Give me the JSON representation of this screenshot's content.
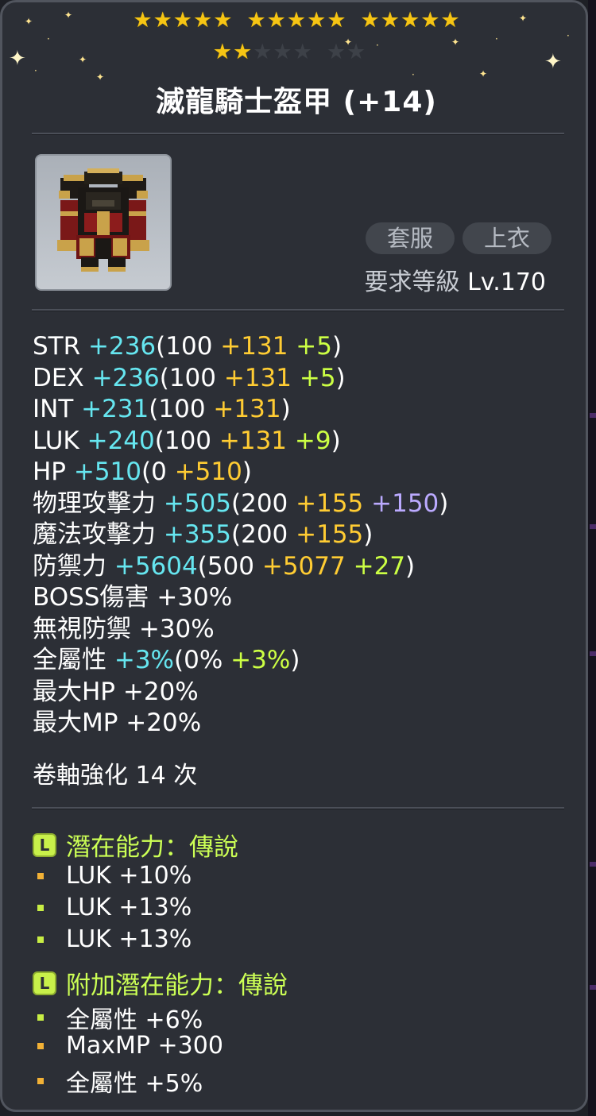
{
  "item": {
    "name": "滅龍騎士盔甲 (+14)",
    "stars_filled": 17,
    "stars_total": 22,
    "tags": [
      "套服",
      "上衣"
    ],
    "req_label": "要求等級",
    "req_value": "Lv.170"
  },
  "stats": [
    {
      "name": "STR",
      "parts": [
        {
          "t": "+236",
          "c": "cyan"
        },
        {
          "t": "(100 ",
          "c": "white"
        },
        {
          "t": "+131 ",
          "c": "gold"
        },
        {
          "t": "+5",
          "c": "lime"
        },
        {
          "t": ")",
          "c": "white"
        }
      ]
    },
    {
      "name": "DEX",
      "parts": [
        {
          "t": "+236",
          "c": "cyan"
        },
        {
          "t": "(100 ",
          "c": "white"
        },
        {
          "t": "+131 ",
          "c": "gold"
        },
        {
          "t": "+5",
          "c": "lime"
        },
        {
          "t": ")",
          "c": "white"
        }
      ]
    },
    {
      "name": "INT",
      "parts": [
        {
          "t": "+231",
          "c": "cyan"
        },
        {
          "t": "(100 ",
          "c": "white"
        },
        {
          "t": "+131",
          "c": "gold"
        },
        {
          "t": ")",
          "c": "white"
        }
      ]
    },
    {
      "name": "LUK",
      "parts": [
        {
          "t": "+240",
          "c": "cyan"
        },
        {
          "t": "(100 ",
          "c": "white"
        },
        {
          "t": "+131 ",
          "c": "gold"
        },
        {
          "t": "+9",
          "c": "lime"
        },
        {
          "t": ")",
          "c": "white"
        }
      ]
    },
    {
      "name": "HP",
      "parts": [
        {
          "t": "+510",
          "c": "cyan"
        },
        {
          "t": "(0 ",
          "c": "white"
        },
        {
          "t": "+510",
          "c": "gold"
        },
        {
          "t": ")",
          "c": "white"
        }
      ]
    },
    {
      "name": "物理攻擊力",
      "parts": [
        {
          "t": "+505",
          "c": "cyan"
        },
        {
          "t": "(200 ",
          "c": "white"
        },
        {
          "t": "+155 ",
          "c": "gold"
        },
        {
          "t": "+150",
          "c": "purple"
        },
        {
          "t": ")",
          "c": "white"
        }
      ]
    },
    {
      "name": "魔法攻擊力",
      "parts": [
        {
          "t": "+355",
          "c": "cyan"
        },
        {
          "t": "(200 ",
          "c": "white"
        },
        {
          "t": "+155",
          "c": "gold"
        },
        {
          "t": ")",
          "c": "white"
        }
      ]
    },
    {
      "name": "防禦力",
      "parts": [
        {
          "t": "+5604",
          "c": "cyan"
        },
        {
          "t": "(500 ",
          "c": "white"
        },
        {
          "t": "+5077 ",
          "c": "gold"
        },
        {
          "t": "+27",
          "c": "lime"
        },
        {
          "t": ")",
          "c": "white"
        }
      ]
    },
    {
      "name": "BOSS傷害",
      "parts": [
        {
          "t": "+30%",
          "c": "white"
        }
      ]
    },
    {
      "name": "無視防禦",
      "parts": [
        {
          "t": "+30%",
          "c": "white"
        }
      ]
    },
    {
      "name": "全屬性",
      "parts": [
        {
          "t": "+3%",
          "c": "cyan"
        },
        {
          "t": "(0% ",
          "c": "white"
        },
        {
          "t": "+3%",
          "c": "lime"
        },
        {
          "t": ")",
          "c": "white"
        }
      ]
    },
    {
      "name": "最大HP",
      "parts": [
        {
          "t": "+20%",
          "c": "white"
        }
      ]
    },
    {
      "name": "最大MP",
      "parts": [
        {
          "t": "+20%",
          "c": "white"
        }
      ]
    }
  ],
  "scroll_text": "卷軸強化 14 次",
  "potential": {
    "badge": "L",
    "title": "潛在能力：傳說",
    "lines": [
      {
        "text": "LUK +10%",
        "bullet": "#f2b136"
      },
      {
        "text": "LUK +13%",
        "bullet": "#c8ee44"
      },
      {
        "text": "LUK +13%",
        "bullet": "#c8ee44"
      }
    ]
  },
  "additional": {
    "badge": "L",
    "title": "附加潛在能力：傳說",
    "lines": [
      {
        "text": "全屬性 +6%",
        "bullet": "#c8ee44"
      },
      {
        "text": "MaxMP +300",
        "bullet": "#f2b136"
      },
      {
        "text": "全屬性 +5%",
        "bullet": "#f2b136"
      }
    ]
  }
}
